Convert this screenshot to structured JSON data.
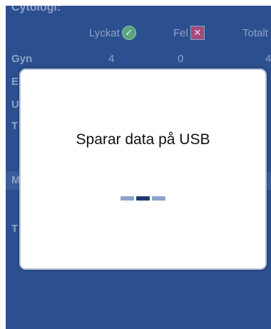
{
  "background": {
    "section_title": "Cytologi:",
    "columns": {
      "success_label": "Lyckat",
      "success_icon": "check-circle-icon",
      "error_label": "Fel",
      "error_icon": "x-box-icon",
      "total_label": "Totalt"
    },
    "rows": [
      {
        "label": "Gyn",
        "success": "4",
        "error": "0",
        "total": "4"
      },
      {
        "label": "E",
        "success": "",
        "error": "",
        "total": ""
      },
      {
        "label": "U",
        "success": "",
        "error": "",
        "total": ""
      },
      {
        "label": "T",
        "success": "",
        "error": "",
        "total": ""
      },
      {
        "label": "M",
        "success": "",
        "error": "",
        "total": ""
      },
      {
        "label": "T",
        "success": "",
        "error": "",
        "total": ""
      }
    ]
  },
  "modal": {
    "title": "Sparar data på USB",
    "progress_active_index": 1,
    "progress_segments": 3
  },
  "colors": {
    "screen_bg": "#2c4f8f",
    "muted_text": "#8ea3c9",
    "active_dash": "#1f3c6e"
  }
}
